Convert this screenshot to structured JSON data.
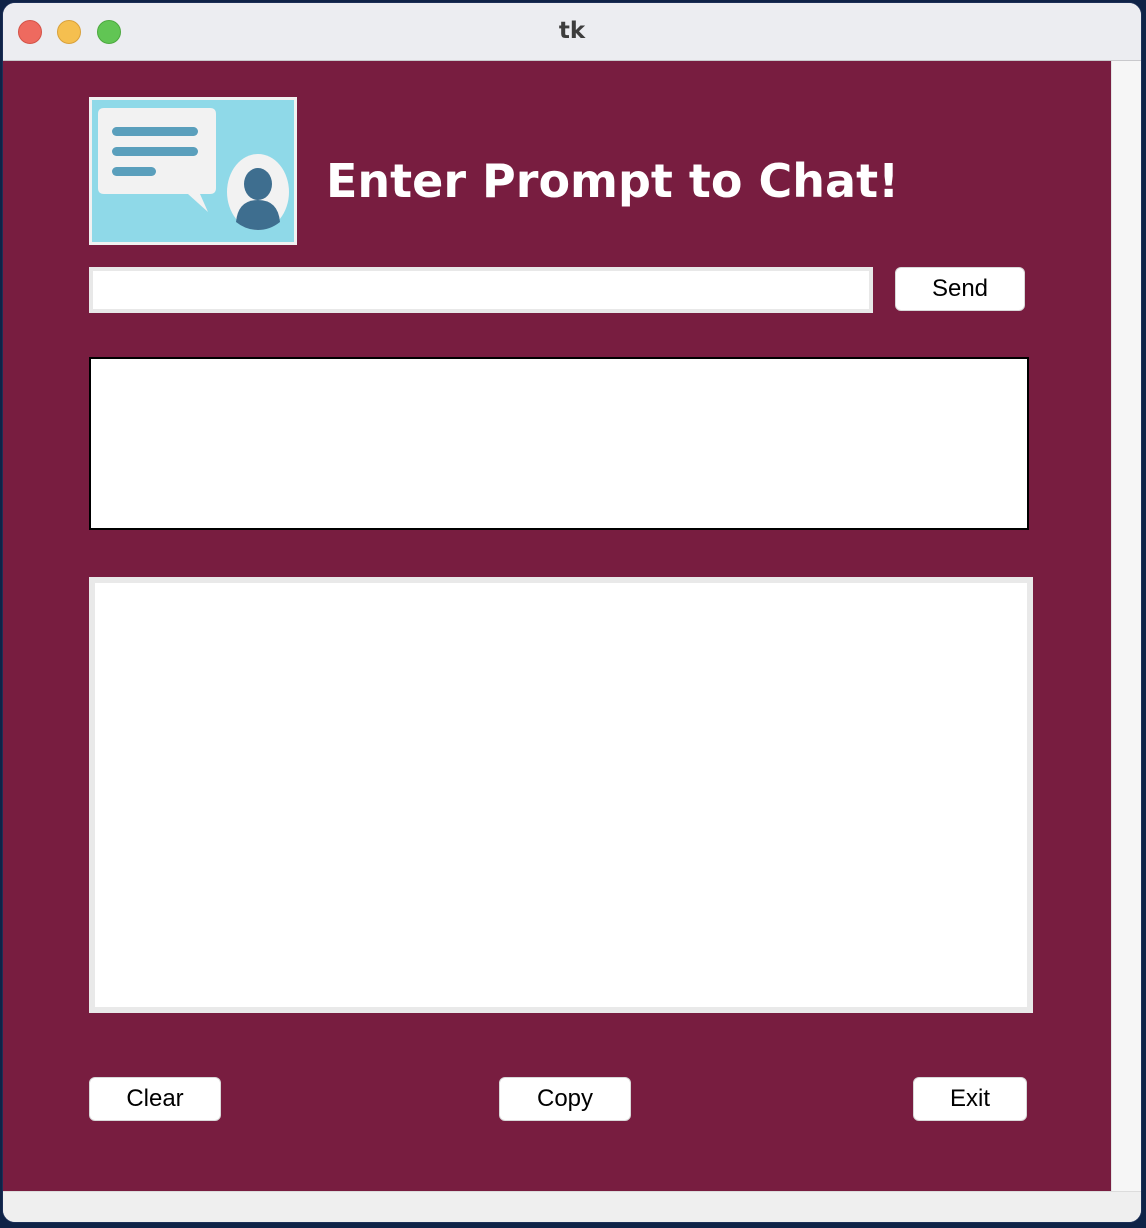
{
  "window": {
    "title": "tk"
  },
  "header": {
    "logo_icon": "chat-user-icon",
    "title": "Enter Prompt to Chat!"
  },
  "prompt": {
    "value": "",
    "send_label": "Send"
  },
  "response": {
    "text": ""
  },
  "history": {
    "text": ""
  },
  "footer": {
    "clear_label": "Clear",
    "copy_label": "Copy",
    "exit_label": "Exit"
  },
  "colors": {
    "background": "#781d40",
    "logo_background": "#8fd9e8",
    "bubble_lines": "#5a9fbc",
    "avatar": "#3e6e8f"
  }
}
